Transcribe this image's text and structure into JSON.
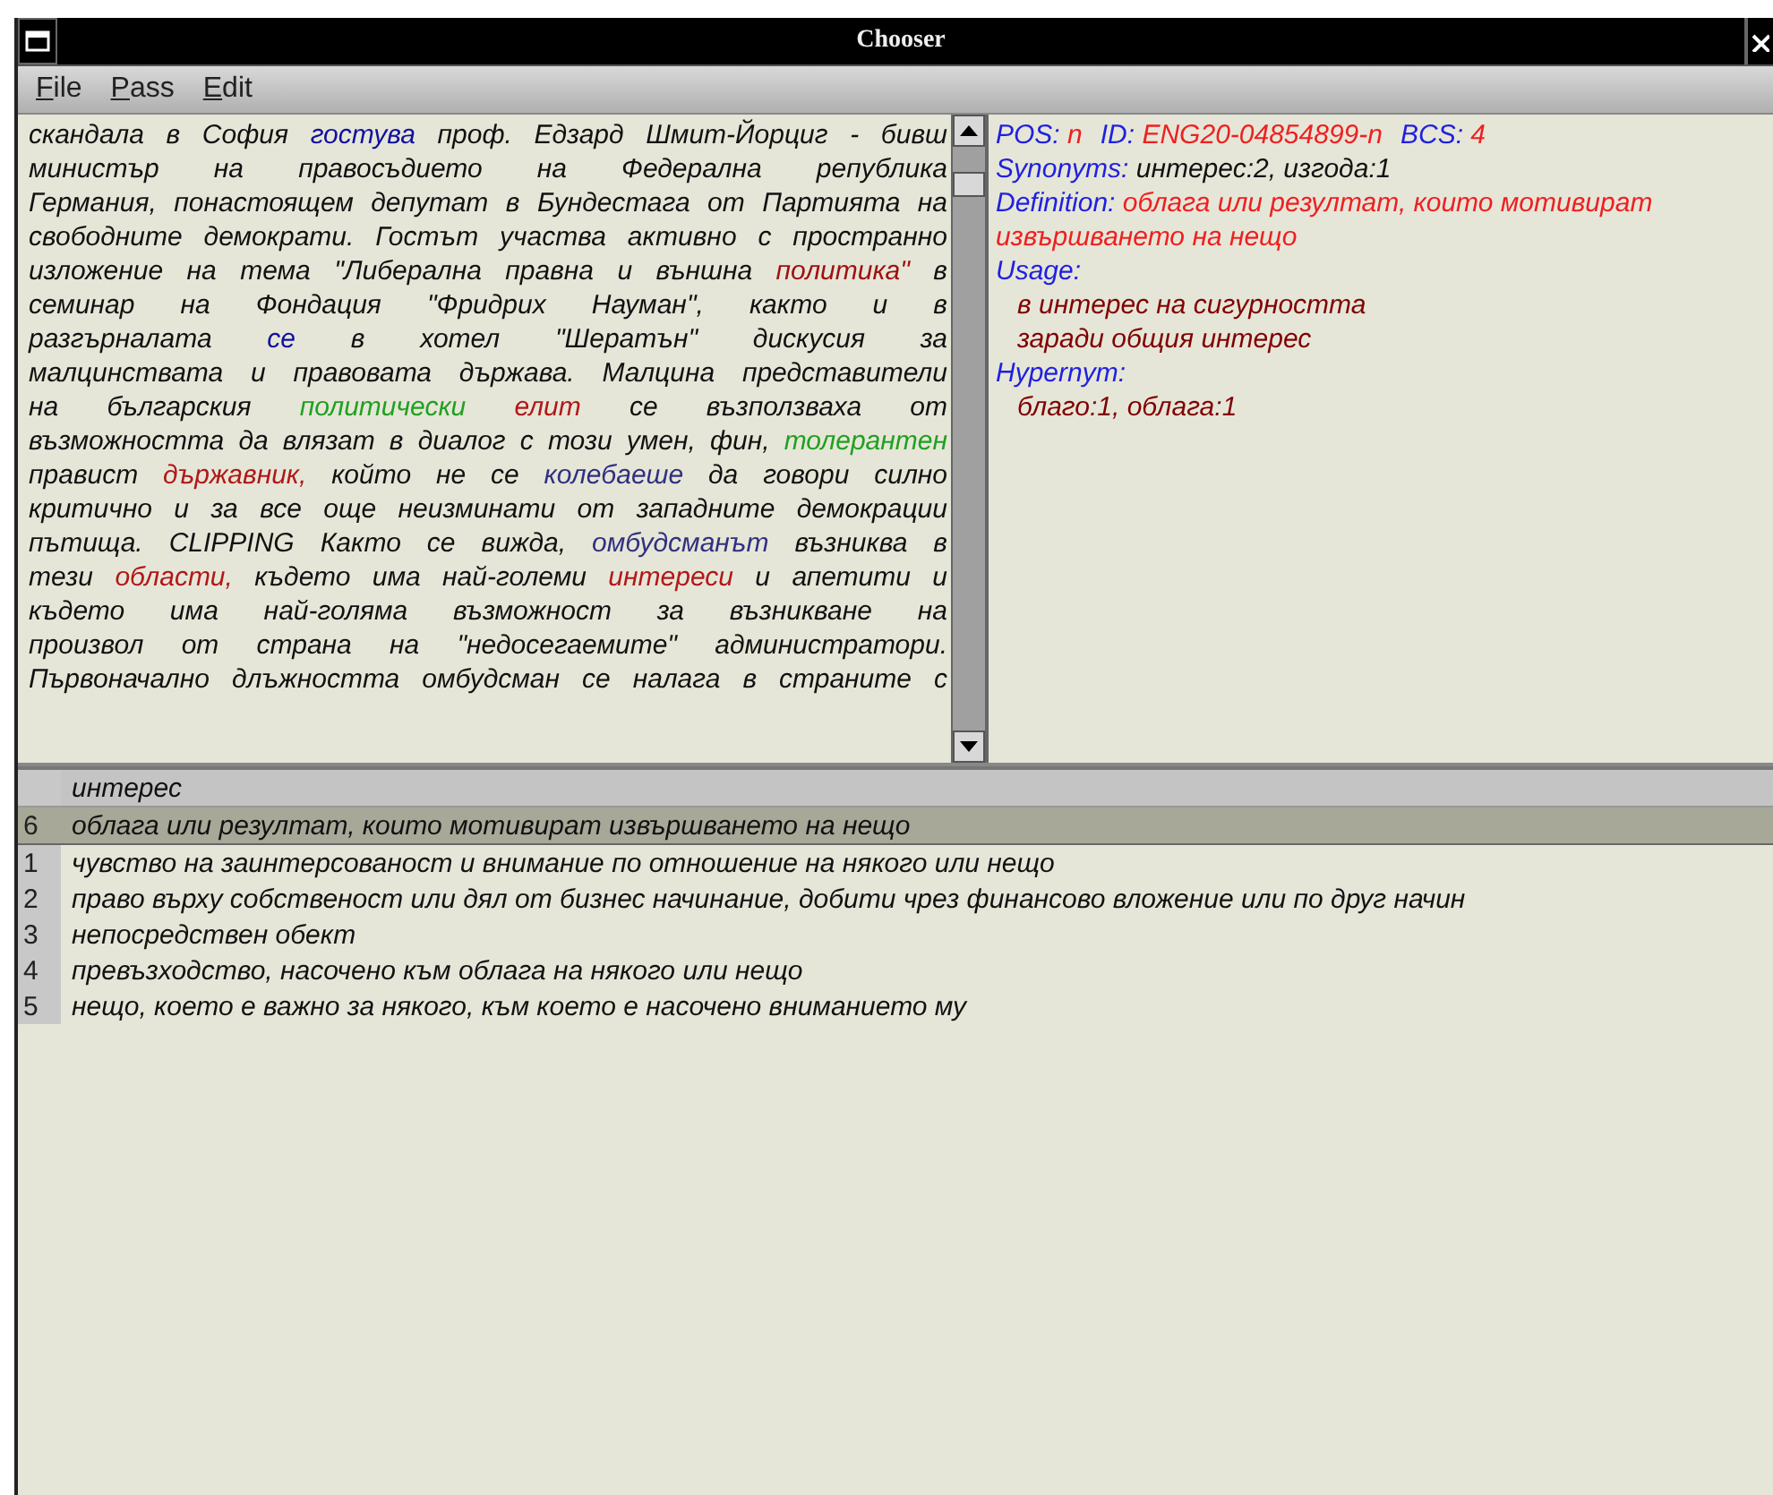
{
  "window": {
    "title": "Chooser"
  },
  "menu": [
    {
      "label": "File"
    },
    {
      "label": "Pass"
    },
    {
      "label": "Edit"
    }
  ],
  "article": {
    "lines": [
      [
        {
          "t": "скандала в София "
        },
        {
          "t": "гостува",
          "color": "#1010a0"
        },
        {
          "t": " проф. Едзард Шмит-Йорциг - бивш"
        }
      ],
      [
        {
          "t": "министър на правосъдието на Федерална република"
        }
      ],
      [
        {
          "t": "Германия, понастоящем депутат в Бундестага от Партията на"
        }
      ],
      [
        {
          "t": "свободните демократи. Гостът участва активно с пространно"
        }
      ],
      [
        {
          "t": "изложение на тема \"Либерална правна и външна "
        },
        {
          "t": "политика\"",
          "color": "#a01010"
        },
        {
          "t": " в"
        }
      ],
      [
        {
          "t": "семинар на Фондация \"Фридрих Науман\", както и в"
        }
      ],
      [
        {
          "t": "разгърналата "
        },
        {
          "t": "се",
          "color": "#1010a0"
        },
        {
          "t": " в хотел \"Шератън\" дискусия за"
        }
      ],
      [
        {
          "t": "малцинствата и правовата държава. Малцина представители"
        }
      ],
      [
        {
          "t": "на българския "
        },
        {
          "t": "политически ",
          "color": "#20a020"
        },
        {
          "t": "елит",
          "color": "#b01818"
        },
        {
          "t": " се възползваха от"
        }
      ],
      [
        {
          "t": "възможността да влязат в диалог с този умен, фин, "
        },
        {
          "t": "толерантен",
          "color": "#20a020"
        }
      ],
      [
        {
          "t": "правист "
        },
        {
          "t": "държавник,",
          "color": "#b01818"
        },
        {
          "t": " който не се "
        },
        {
          "t": "колебаеше",
          "color": "#303080"
        },
        {
          "t": " да говори силно"
        }
      ],
      [
        {
          "t": "критично и за все още неизминати от западните демокрации"
        }
      ],
      [
        {
          "t": "пътища. CLIPPING Както се вижда, "
        },
        {
          "t": "омбудсманът",
          "color": "#303080"
        },
        {
          "t": " възниква в"
        }
      ],
      [
        {
          "t": "тези "
        },
        {
          "t": "области,",
          "color": "#b01818"
        },
        {
          "t": " където има най-големи "
        },
        {
          "t": "интереси",
          "color": "#b01818"
        },
        {
          "t": " и апетити и"
        }
      ],
      [
        {
          "t": "където има най-голяма възможност за възникване на"
        }
      ],
      [
        {
          "t": "произвол от страна на \"недосегаемите\" администратори."
        }
      ],
      [
        {
          "t": "Първоначално длъжността омбудсман се налага в страните с"
        }
      ]
    ]
  },
  "info": {
    "header": [
      {
        "label": "POS:",
        "value": "n"
      },
      {
        "label": "ID:",
        "value": "ENG20-04854899-n"
      },
      {
        "label": "BCS:",
        "value": "4"
      }
    ],
    "synonyms": {
      "label": "Synonyms:",
      "value": "интерес:2, изгода:1"
    },
    "definition": {
      "label": "Definition:",
      "value": "облага или резултат, които мотивират извършването на нещо"
    },
    "usage": {
      "label": "Usage:",
      "items": [
        "в интерес на сигурността",
        "заради общия интерес"
      ]
    },
    "hypernym": {
      "label": "Hypernym:",
      "items": [
        "благо:1, облага:1"
      ]
    }
  },
  "senses": {
    "header": "интерес",
    "rows": [
      {
        "number": "6",
        "text": "облага или резултат, които мотивират извършването на нещо",
        "selected": true
      },
      {
        "number": "1",
        "text": "чувство на заинтерсованост и внимание по отношение на някого или нещо",
        "selected": false
      },
      {
        "number": "2",
        "text": "право върху собственост или дял от бизнес начинание, добити чрез финансово вложение или по друг начин",
        "selected": false
      },
      {
        "number": "3",
        "text": "непосредствен обект",
        "selected": false
      },
      {
        "number": "4",
        "text": "превъзходство, насочено към облага на някого или нещо",
        "selected": false
      },
      {
        "number": "5",
        "text": "нещо, което е важно за някого, към което е насочено вниманието му",
        "selected": false
      }
    ]
  }
}
